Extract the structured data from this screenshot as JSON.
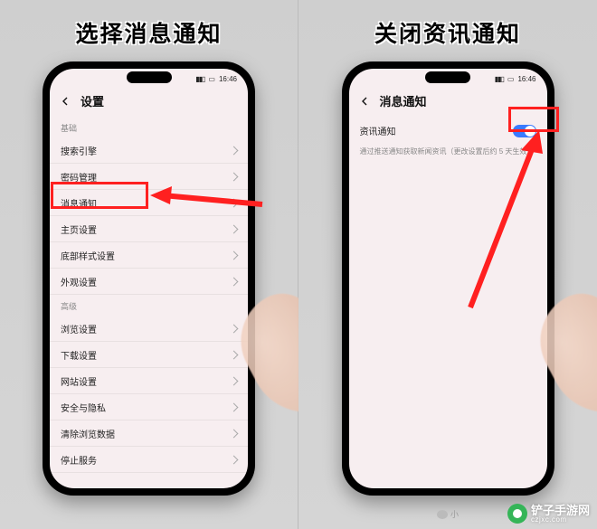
{
  "left": {
    "caption": "选择消息通知",
    "status": {
      "time": "16:46"
    },
    "screen_title": "设置",
    "sections": [
      {
        "header": "基础",
        "items": [
          "搜索引擎",
          "密码管理",
          "消息通知",
          "主页设置",
          "底部样式设置",
          "外观设置"
        ]
      },
      {
        "header": "高级",
        "items": [
          "浏览设置",
          "下载设置",
          "网站设置",
          "安全与隐私",
          "清除浏览数据",
          "停止服务"
        ]
      }
    ],
    "highlighted_item": "消息通知"
  },
  "right": {
    "caption": "关闭资讯通知",
    "status": {
      "time": "16:46"
    },
    "screen_title": "消息通知",
    "toggle": {
      "label": "资讯通知",
      "on": true
    },
    "description": "通过推送通知获取新闻资讯（更改设置后约 5 天生效）"
  },
  "watermark": {
    "source_label": "小",
    "brand": "铲子手游网",
    "brand_url": "czjxc.com"
  },
  "colors": {
    "accent_blue": "#3a7bff",
    "accent_red": "#ff2020"
  }
}
